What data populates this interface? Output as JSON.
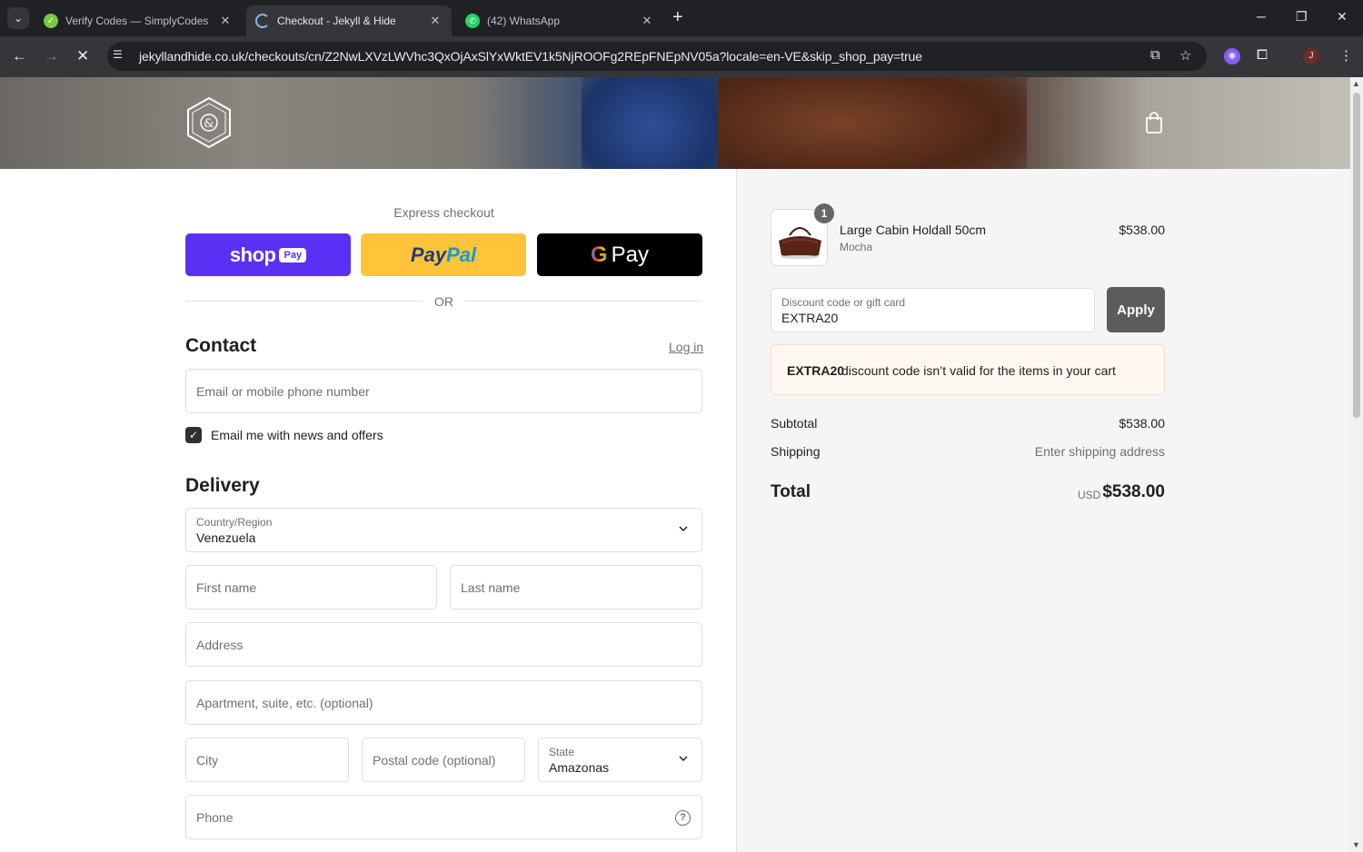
{
  "browser": {
    "tabs": [
      {
        "title": "Verify Codes — SimplyCodes",
        "active": false
      },
      {
        "title": "Checkout - Jekyll & Hide",
        "active": true
      },
      {
        "title": "(42) WhatsApp",
        "active": false
      }
    ],
    "url": "jekyllandhide.co.uk/checkouts/cn/Z2NwLXVzLWVhc3QxOjAxSlYxWktEV1k5NjROOFg2REpFNEpNV05a?locale=en-VE&skip_shop_pay=true",
    "profile_initial": "J"
  },
  "express": {
    "label": "Express checkout",
    "shop_text": "shop",
    "shop_badge": "Pay",
    "paypal_part1": "Pay",
    "paypal_part2": "Pal",
    "gpay_g": "G",
    "gpay_text": "Pay",
    "or_text": "OR"
  },
  "contact": {
    "title": "Contact",
    "login_link": "Log in",
    "email_placeholder": "Email or mobile phone number",
    "newsletter_label": "Email me with news and offers",
    "newsletter_checked": true
  },
  "delivery": {
    "title": "Delivery",
    "country_label": "Country/Region",
    "country_value": "Venezuela",
    "first_name_placeholder": "First name",
    "last_name_placeholder": "Last name",
    "address_placeholder": "Address",
    "apartment_placeholder": "Apartment, suite, etc. (optional)",
    "city_placeholder": "City",
    "postal_placeholder": "Postal code (optional)",
    "state_label": "State",
    "state_value": "Amazonas",
    "phone_placeholder": "Phone"
  },
  "summary": {
    "item": {
      "quantity": "1",
      "name": "Large Cabin Holdall 50cm",
      "variant": "Mocha",
      "price": "$538.00"
    },
    "discount_label": "Discount code or gift card",
    "discount_value": "EXTRA20",
    "apply_label": "Apply",
    "error_code": "EXTRA20",
    "error_message": "discount code isn’t valid for the items in your cart",
    "subtotal_label": "Subtotal",
    "subtotal_value": "$538.00",
    "shipping_label": "Shipping",
    "shipping_value": "Enter shipping address",
    "total_label": "Total",
    "total_currency": "USD",
    "total_value": "$538.00"
  },
  "colors": {
    "shop_pay": "#5a31f4",
    "paypal": "#ffc439",
    "gpay": "#000000",
    "apply_button": "#5c5c5c",
    "error_bg": "#fff8f1"
  }
}
